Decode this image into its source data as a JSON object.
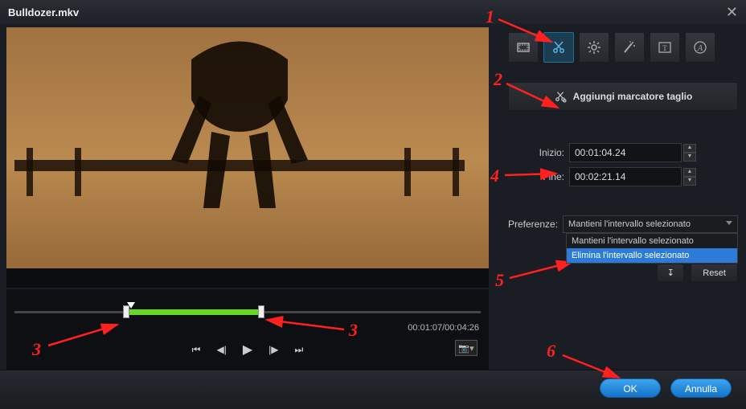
{
  "title": "Bulldozer.mkv",
  "close_glyph": "✕",
  "toolbar": {
    "crop": "crop",
    "cut": "cut",
    "brightness": "brightness",
    "effects": "effects",
    "text": "text",
    "font": "font"
  },
  "add_marker_label": "Aggiungi marcatore taglio",
  "fields": {
    "start_label": "Inizio:",
    "start_value": "00:01:04.24",
    "end_label": "Fine:",
    "end_value": "00:02:21.14"
  },
  "pref": {
    "label": "Preferenze:",
    "selected": "Mantieni l'intervallo selezionato",
    "options": [
      "Mantieni l'intervallo selezionato",
      "Elimina l'intervallo selezionato"
    ]
  },
  "reset_icon": "↧",
  "reset_label": "Reset",
  "timeline": {
    "current": "00:01:07",
    "total": "00:04:26",
    "separator": "/",
    "segment_start_pct": 24,
    "segment_end_pct": 53,
    "playhead_pct": 25
  },
  "playback": {
    "first": "⏮",
    "prev_frame": "◀|",
    "play": "▶",
    "next_frame": "|▶",
    "last": "⏭",
    "snapshot": "📷▾"
  },
  "footer": {
    "ok": "OK",
    "cancel": "Annulla"
  },
  "annotations": {
    "n1": "1",
    "n2": "2",
    "n3a": "3",
    "n3b": "3",
    "n4": "4",
    "n5": "5",
    "n6": "6"
  }
}
